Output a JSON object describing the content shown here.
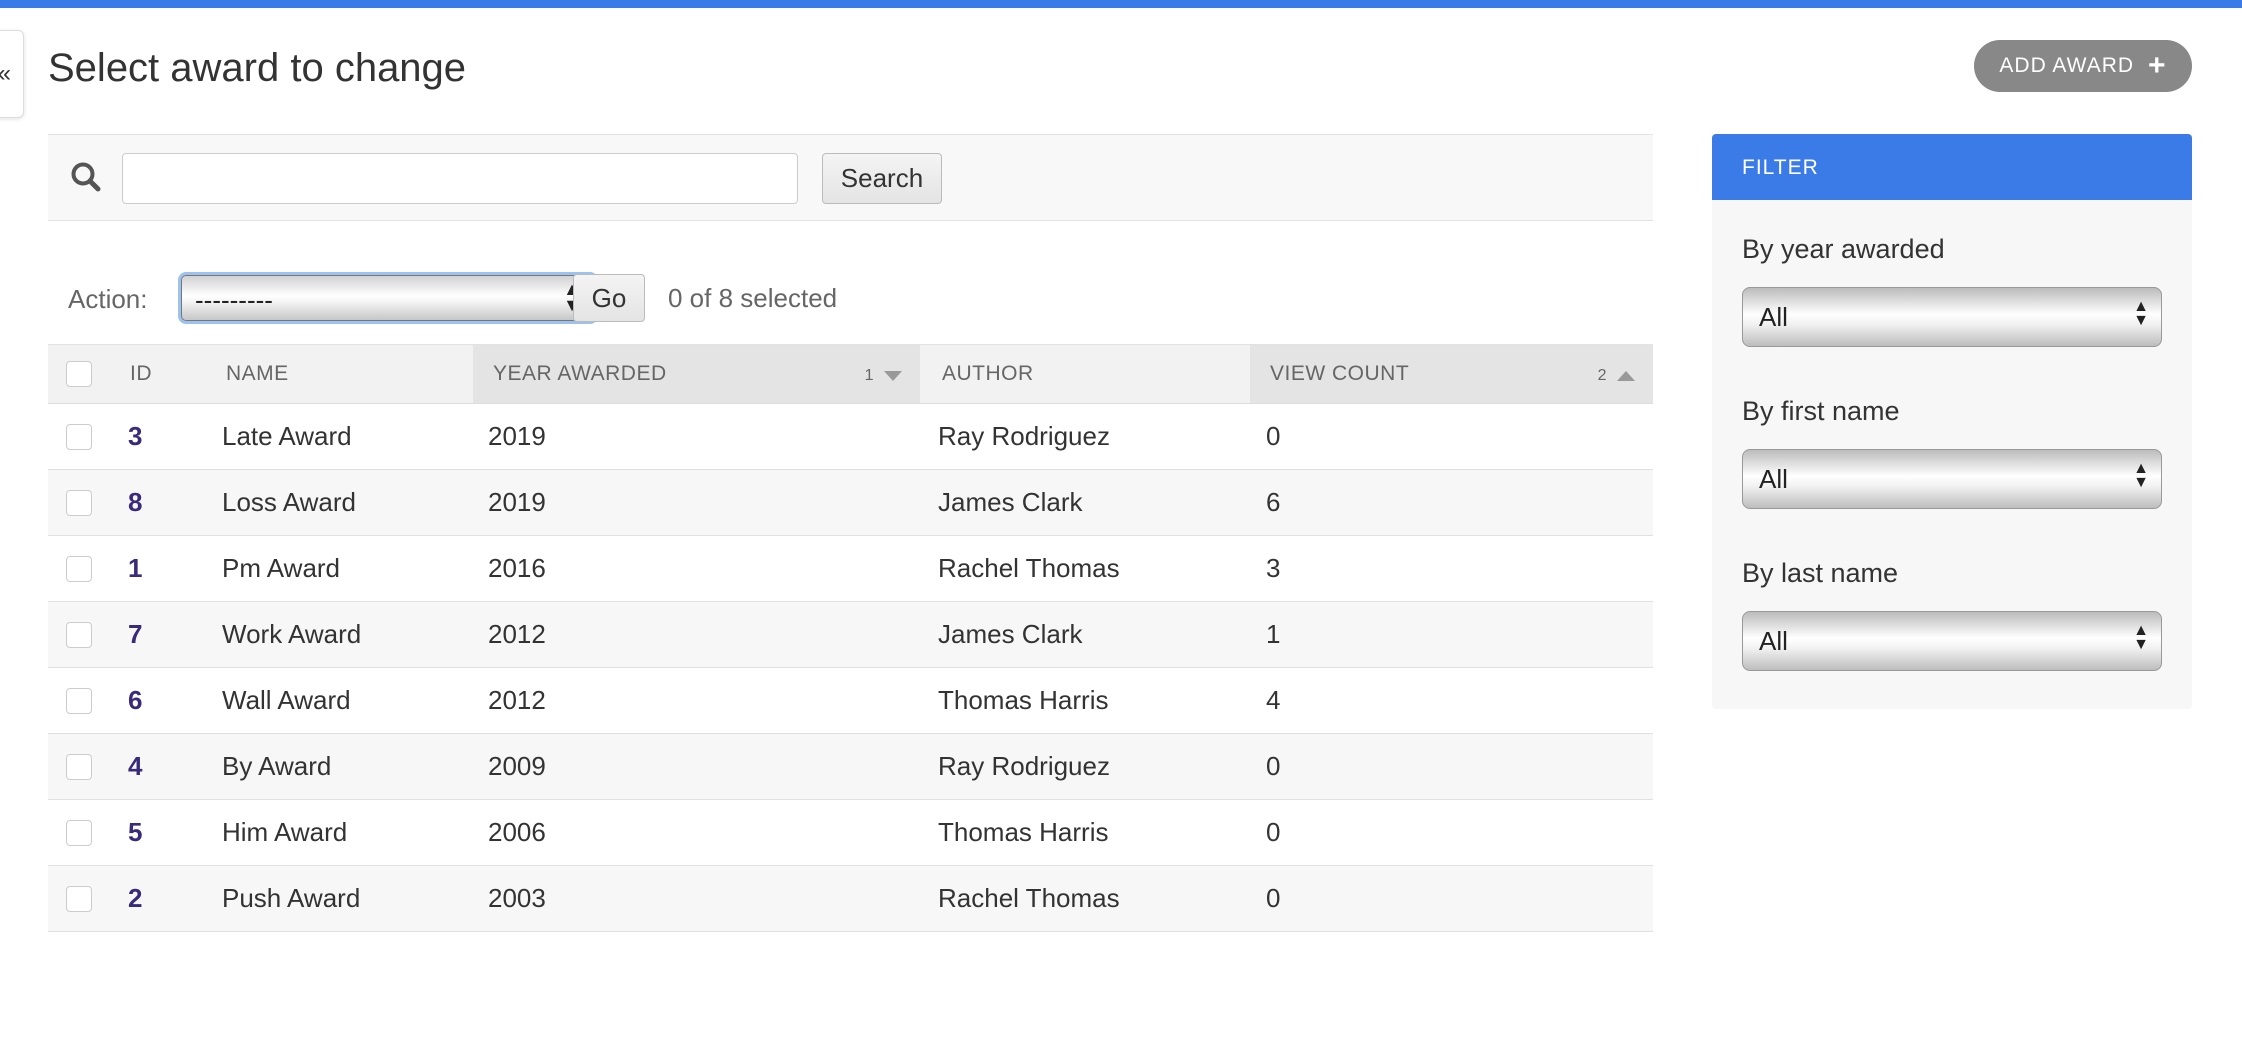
{
  "page": {
    "title": "Select award to change",
    "add_button_label": "ADD AWARD",
    "collapse_glyph": "«"
  },
  "search": {
    "value": "",
    "button_label": "Search"
  },
  "actions": {
    "label": "Action:",
    "selected_option": "---------",
    "go_label": "Go",
    "selected_count": "0 of 8 selected"
  },
  "table": {
    "columns": [
      {
        "label": "ID"
      },
      {
        "label": "NAME"
      },
      {
        "label": "YEAR AWARDED",
        "sort_priority": "1",
        "sort_direction": "descending"
      },
      {
        "label": "AUTHOR"
      },
      {
        "label": "VIEW COUNT",
        "sort_priority": "2",
        "sort_direction": "ascending"
      }
    ],
    "rows": [
      {
        "id": "3",
        "name": "Late Award",
        "year": "2019",
        "author": "Ray Rodriguez",
        "views": "0"
      },
      {
        "id": "8",
        "name": "Loss Award",
        "year": "2019",
        "author": "James Clark",
        "views": "6"
      },
      {
        "id": "1",
        "name": "Pm Award",
        "year": "2016",
        "author": "Rachel Thomas",
        "views": "3"
      },
      {
        "id": "7",
        "name": "Work Award",
        "year": "2012",
        "author": "James Clark",
        "views": "1"
      },
      {
        "id": "6",
        "name": "Wall Award",
        "year": "2012",
        "author": "Thomas Harris",
        "views": "4"
      },
      {
        "id": "4",
        "name": "By Award",
        "year": "2009",
        "author": "Ray Rodriguez",
        "views": "0"
      },
      {
        "id": "5",
        "name": "Him Award",
        "year": "2006",
        "author": "Thomas Harris",
        "views": "0"
      },
      {
        "id": "2",
        "name": "Push Award",
        "year": "2003",
        "author": "Rachel Thomas",
        "views": "0"
      }
    ]
  },
  "filter": {
    "title": "FILTER",
    "groups": [
      {
        "label": "By year awarded",
        "selected": "All"
      },
      {
        "label": "By first name",
        "selected": "All"
      },
      {
        "label": "By last name",
        "selected": "All"
      }
    ]
  },
  "colors": {
    "accent": "#3a7be8",
    "add_button": "#888888",
    "id_link": "#3a2a7a"
  }
}
